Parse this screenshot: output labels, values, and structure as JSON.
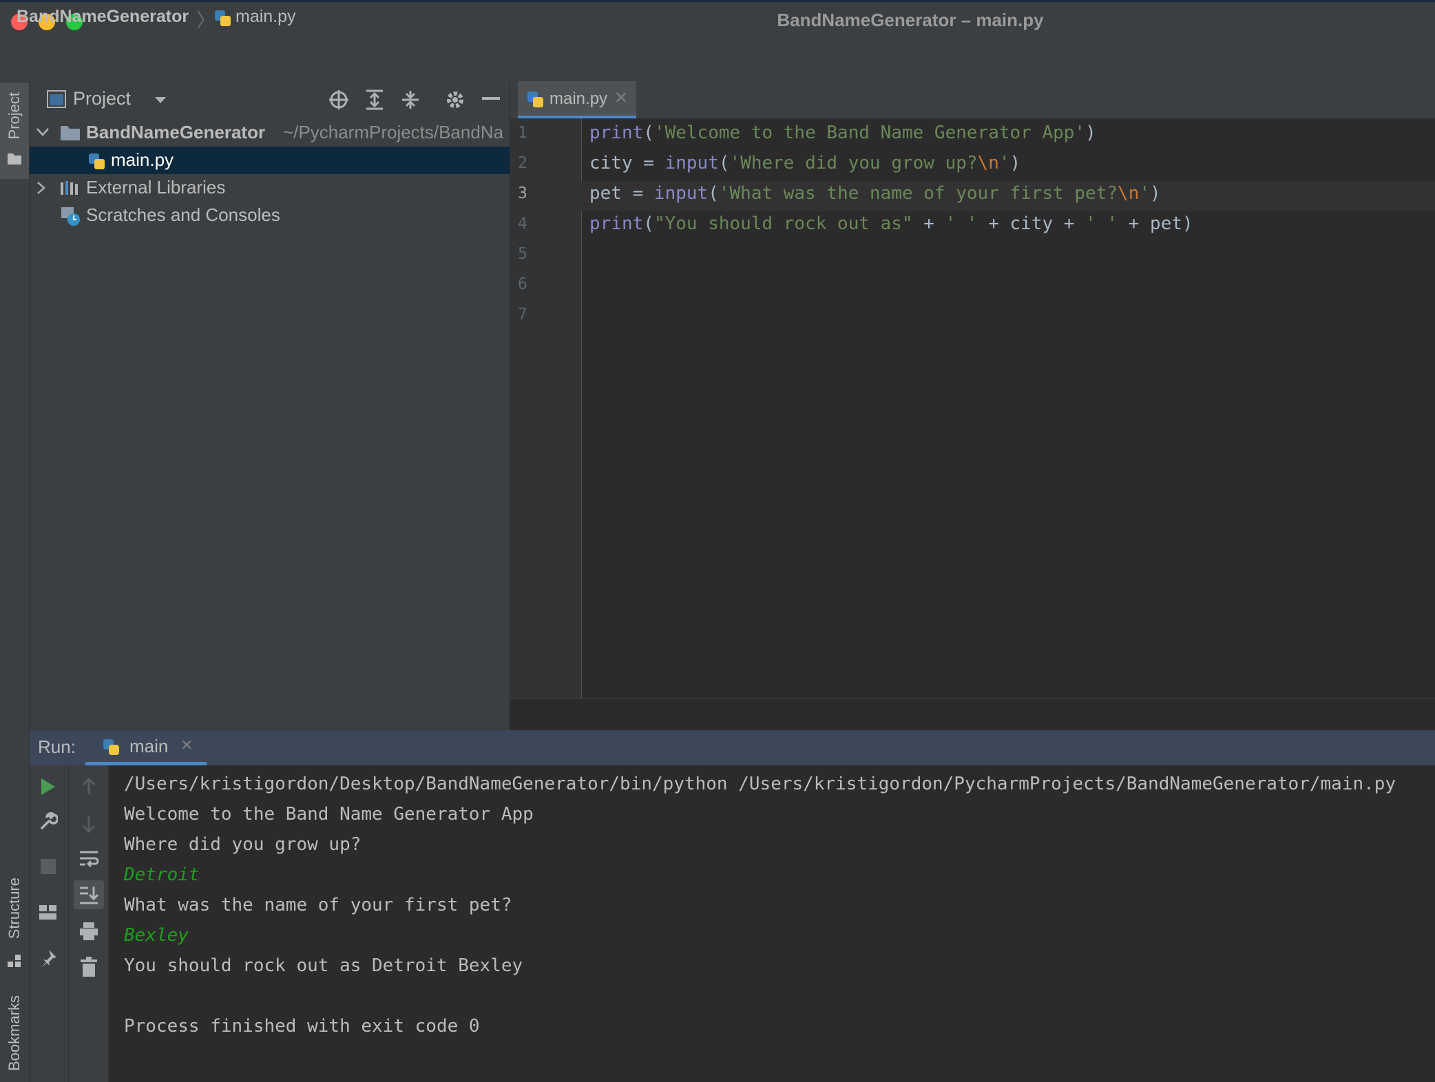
{
  "window": {
    "title": "BandNameGenerator – main.py",
    "colors": {
      "close": "#ff5f57",
      "minimize": "#febc2e",
      "maximize": "#28c840"
    }
  },
  "navbar": {
    "project": "BandNameGenerator",
    "file": "main.py"
  },
  "left_strip": {
    "project_label": "Project",
    "structure_label": "Structure",
    "bookmarks_label": "Bookmarks"
  },
  "project_panel": {
    "title": "Project",
    "tree": {
      "root_name": "BandNameGenerator",
      "root_path": "~/PycharmProjects/BandNa",
      "file": "main.py",
      "external": "External Libraries",
      "scratches": "Scratches and Consoles"
    }
  },
  "editor": {
    "tab": "main.py",
    "current_line": 3,
    "line_numbers": [
      "1",
      "2",
      "3",
      "4",
      "5",
      "6",
      "7"
    ],
    "lines": [
      [
        {
          "t": "print",
          "c": "kw-fn"
        },
        {
          "t": "(",
          "c": ""
        },
        {
          "t": "'Welcome to the Band Name Generator App'",
          "c": "str"
        },
        {
          "t": ")",
          "c": ""
        }
      ],
      [
        {
          "t": "city = ",
          "c": ""
        },
        {
          "t": "input",
          "c": "kw-fn"
        },
        {
          "t": "(",
          "c": ""
        },
        {
          "t": "'Where did you grow up?",
          "c": "str"
        },
        {
          "t": "\\n",
          "c": "esc"
        },
        {
          "t": "'",
          "c": "str"
        },
        {
          "t": ")",
          "c": ""
        }
      ],
      [
        {
          "t": "pet = ",
          "c": ""
        },
        {
          "t": "input",
          "c": "kw-fn"
        },
        {
          "t": "(",
          "c": ""
        },
        {
          "t": "'What was the name of your first pet?",
          "c": "str"
        },
        {
          "t": "\\n",
          "c": "esc"
        },
        {
          "t": "'",
          "c": "str"
        },
        {
          "t": ")",
          "c": ""
        }
      ],
      [
        {
          "t": "print",
          "c": "kw-fn"
        },
        {
          "t": "(",
          "c": ""
        },
        {
          "t": "\"You should rock out as\"",
          "c": "str"
        },
        {
          "t": " + ",
          "c": ""
        },
        {
          "t": "' '",
          "c": "str"
        },
        {
          "t": " + city + ",
          "c": ""
        },
        {
          "t": "' '",
          "c": "str"
        },
        {
          "t": " + pet)",
          "c": ""
        }
      ]
    ]
  },
  "run_panel": {
    "label": "Run:",
    "tab": "main",
    "console": [
      {
        "t": "/Users/kristigordon/Desktop/BandNameGenerator/bin/python /Users/kristigordon/PycharmProjects/BandNameGenerator/main.py",
        "input": false
      },
      {
        "t": "Welcome to the Band Name Generator App",
        "input": false
      },
      {
        "t": "Where did you grow up?",
        "input": false
      },
      {
        "t": "Detroit",
        "input": true
      },
      {
        "t": "What was the name of your first pet?",
        "input": false
      },
      {
        "t": "Bexley",
        "input": true
      },
      {
        "t": "You should rock out as Detroit Bexley",
        "input": false
      },
      {
        "t": "",
        "input": false
      },
      {
        "t": "Process finished with exit code 0",
        "input": false
      }
    ]
  }
}
